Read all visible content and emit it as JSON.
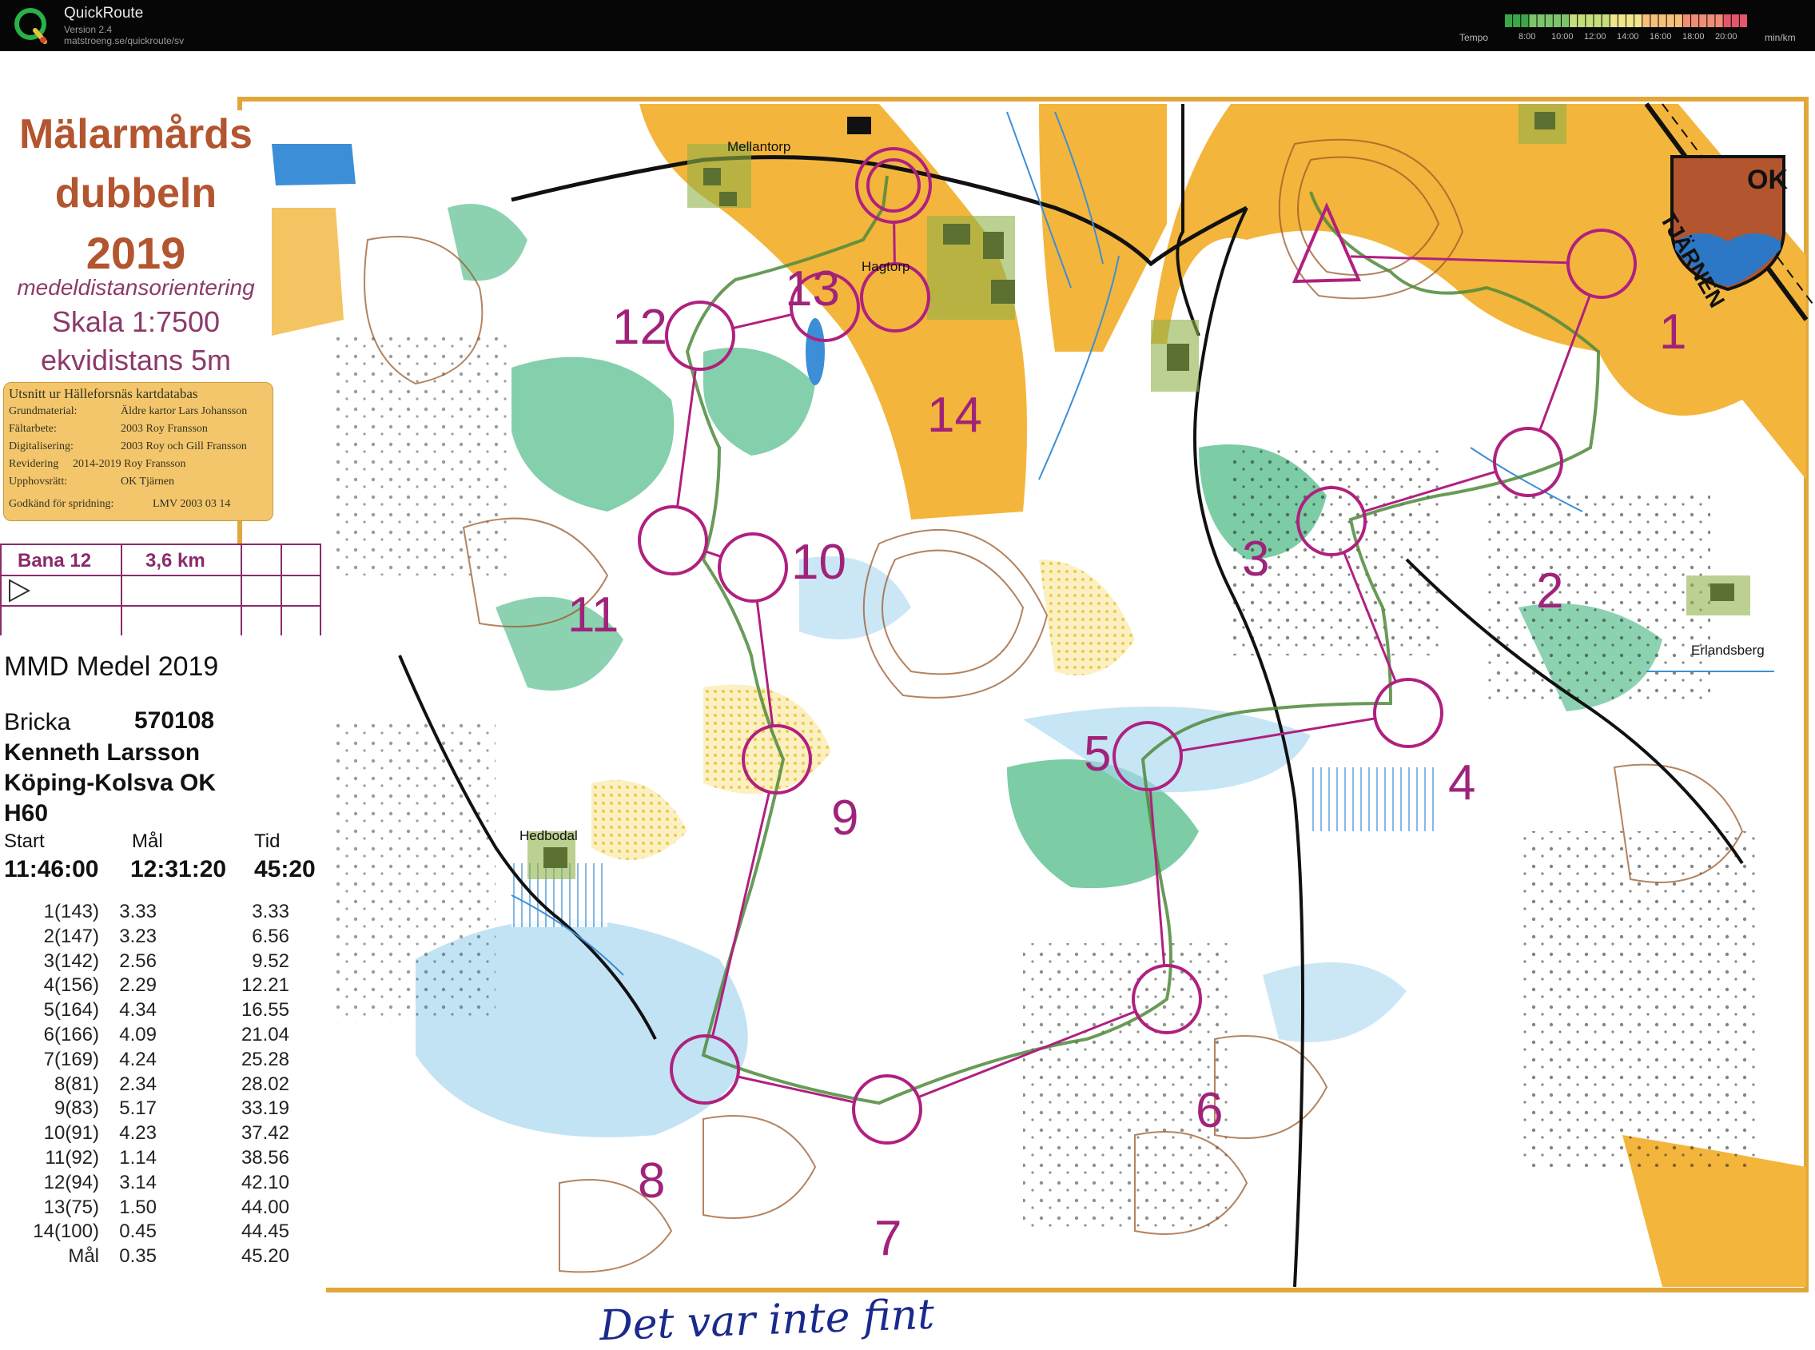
{
  "app": {
    "name": "QuickRoute",
    "version": "Version 2.4",
    "url": "matstroeng.se/quickroute/sv"
  },
  "tempo_legend": {
    "label": "Tempo",
    "ticks": [
      "8:00",
      "10:00",
      "12:00",
      "14:00",
      "16:00",
      "18:00",
      "20:00"
    ],
    "unit": "min/km",
    "colors": [
      "#3aa64a",
      "#7cc56a",
      "#c5dd7a",
      "#f2e58a",
      "#f5c07a",
      "#ef8d77",
      "#e3566b"
    ]
  },
  "map": {
    "title_lines": [
      "Mälarmårds",
      "dubbeln",
      "2019"
    ],
    "subtitle": "medeldistansorientering",
    "scale": "Skala 1:7500",
    "contour_interval": "ekvidistans 5m",
    "credits": {
      "heading": "Utsnitt ur Hälleforsnäs kartdatabas",
      "rows": [
        {
          "k": "Grundmaterial:",
          "v": "Äldre kartor Lars Johansson"
        },
        {
          "k": "Fältarbete:",
          "v": "2003   Roy Fransson"
        },
        {
          "k": "Digitalisering:",
          "v": "2003  Roy och Gill Fransson"
        },
        {
          "k": "Revidering",
          "v": "2014-2019  Roy Fransson"
        },
        {
          "k": "Upphovsrätt:",
          "v": "OK Tjärnen"
        },
        {
          "k": "Godkänd för spridning:",
          "v": "LMV 2003 03 14"
        }
      ]
    },
    "course": {
      "name": "Bana 12",
      "length": "3,6 km"
    },
    "club_logo_text": [
      "OK",
      "TJÄRNEN"
    ],
    "place_names": [
      "Mellantorp",
      "Hagtorp",
      "Hedbodal",
      "Erlandsberg"
    ],
    "control_numbers": [
      "1",
      "2",
      "3",
      "4",
      "5",
      "6",
      "7",
      "8",
      "9",
      "10",
      "11",
      "12",
      "13",
      "14"
    ],
    "handwriting": "Det var inte fint"
  },
  "splits": {
    "title": "MMD Medel 2019",
    "bricka_label": "Bricka",
    "bricka": "570108",
    "runner": "Kenneth Larsson",
    "club": "Köping-Kolsva OK",
    "class": "H60",
    "headers": {
      "start": "Start",
      "finish": "Mål",
      "time": "Tid"
    },
    "start": "11:46:00",
    "finish": "12:31:20",
    "total": "45:20",
    "rows": [
      {
        "c": "1(143)",
        "leg": "3.33",
        "acc": "3.33"
      },
      {
        "c": "2(147)",
        "leg": "3.23",
        "acc": "6.56"
      },
      {
        "c": "3(142)",
        "leg": "2.56",
        "acc": "9.52"
      },
      {
        "c": "4(156)",
        "leg": "2.29",
        "acc": "12.21"
      },
      {
        "c": "5(164)",
        "leg": "4.34",
        "acc": "16.55"
      },
      {
        "c": "6(166)",
        "leg": "4.09",
        "acc": "21.04"
      },
      {
        "c": "7(169)",
        "leg": "4.24",
        "acc": "25.28"
      },
      {
        "c": "8(81)",
        "leg": "2.34",
        "acc": "28.02"
      },
      {
        "c": "9(83)",
        "leg": "5.17",
        "acc": "33.19"
      },
      {
        "c": "10(91)",
        "leg": "4.23",
        "acc": "37.42"
      },
      {
        "c": "11(92)",
        "leg": "1.14",
        "acc": "38.56"
      },
      {
        "c": "12(94)",
        "leg": "3.14",
        "acc": "42.10"
      },
      {
        "c": "13(75)",
        "leg": "1.50",
        "acc": "44.00"
      },
      {
        "c": "14(100)",
        "leg": "0.45",
        "acc": "44.45"
      },
      {
        "c": "Mål",
        "leg": "0.35",
        "acc": "45.20"
      }
    ]
  },
  "colors": {
    "course_magenta": "#b0207f",
    "route_green": "#4f8a3b",
    "open_land": "#f3b53b",
    "forest_green": "#52b88c",
    "water": "#3c8ed6",
    "title_brown": "#b3552f"
  }
}
